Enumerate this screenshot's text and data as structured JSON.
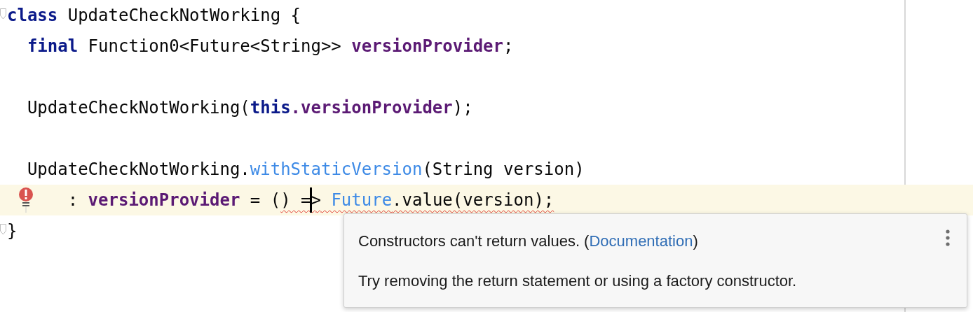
{
  "editor": {
    "lines": [
      {
        "kind": "top",
        "fold": true,
        "tokens": [
          {
            "kind": "keyword",
            "text": "class"
          },
          {
            "kind": "plain",
            "text": " UpdateCheckNotWorking {"
          }
        ]
      },
      {
        "kind": "member",
        "tokens": [
          {
            "kind": "keyword",
            "text": "final"
          },
          {
            "kind": "plain",
            "text": " Function0<Future<String>> "
          },
          {
            "kind": "field",
            "text": "versionProvider"
          },
          {
            "kind": "plain",
            "text": ";"
          }
        ]
      },
      {
        "kind": "blank"
      },
      {
        "kind": "member",
        "tokens": [
          {
            "kind": "plain",
            "text": "UpdateCheckNotWorking("
          },
          {
            "kind": "keyword",
            "text": "this"
          },
          {
            "kind": "field",
            "text": ".versionProvider"
          },
          {
            "kind": "plain",
            "text": ");"
          }
        ]
      },
      {
        "kind": "blank"
      },
      {
        "kind": "member",
        "tokens": [
          {
            "kind": "plain",
            "text": "UpdateCheckNotWorking."
          },
          {
            "kind": "method",
            "text": "withStaticVersion"
          },
          {
            "kind": "plain",
            "text": "(String version)"
          }
        ]
      },
      {
        "kind": "continuation",
        "highlighted": true,
        "error_marker": true,
        "tokens": [
          {
            "kind": "plain",
            "text": ": "
          },
          {
            "kind": "field",
            "text": "versionProvider"
          },
          {
            "kind": "plain",
            "text": " = ("
          },
          {
            "kind": "plain",
            "text": ") =",
            "error": true
          },
          {
            "kind": "plain",
            "text": ">",
            "error": true,
            "caret_before": true
          },
          {
            "kind": "method",
            "text": " Future",
            "error": true
          },
          {
            "kind": "plain",
            "text": ".value(version);",
            "error": true
          }
        ]
      },
      {
        "kind": "top",
        "fold": true,
        "tokens": [
          {
            "kind": "plain",
            "text": "}"
          }
        ]
      }
    ]
  },
  "popup": {
    "message": "Constructors can't return values. (",
    "link": "Documentation",
    "message_end": ")",
    "hint": "Try removing the return statement or using a factory constructor."
  }
}
